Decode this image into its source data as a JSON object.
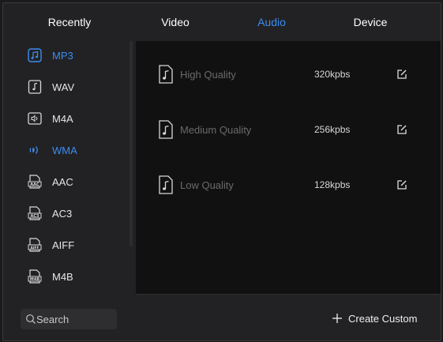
{
  "tabs": [
    {
      "label": "Recently",
      "active": false
    },
    {
      "label": "Video",
      "active": false
    },
    {
      "label": "Audio",
      "active": true
    },
    {
      "label": "Device",
      "active": false
    }
  ],
  "sidebar": {
    "items": [
      {
        "label": "MP3",
        "icon": "music-note-icon",
        "selected": true
      },
      {
        "label": "WAV",
        "icon": "wav-file-icon",
        "selected": false
      },
      {
        "label": "M4A",
        "icon": "m4a-file-icon",
        "selected": false
      },
      {
        "label": "WMA",
        "icon": "wma-speaker-icon",
        "selected": true
      },
      {
        "label": "AAC",
        "icon": "aac-file-icon",
        "selected": false
      },
      {
        "label": "AC3",
        "icon": "ac3-file-icon",
        "selected": false
      },
      {
        "label": "AIFF",
        "icon": "aiff-file-icon",
        "selected": false
      },
      {
        "label": "M4B",
        "icon": "m4b-file-icon",
        "selected": false
      }
    ],
    "file_badges": {
      "aac": "AAC",
      "ac3": "AC3",
      "aiff": "AIFF",
      "m4b": "M4B"
    }
  },
  "search": {
    "placeholder": "Search",
    "value": ""
  },
  "qualities": [
    {
      "label": "High Quality",
      "bitrate": "320kpbs"
    },
    {
      "label": "Medium Quality",
      "bitrate": "256kpbs"
    },
    {
      "label": "Low Quality",
      "bitrate": "128kpbs"
    }
  ],
  "footer": {
    "create_label": "Create Custom"
  },
  "colors": {
    "accent": "#3c8cf0",
    "panel": "#222224",
    "content_bg": "#111111",
    "muted_text": "#6a6a6a"
  }
}
